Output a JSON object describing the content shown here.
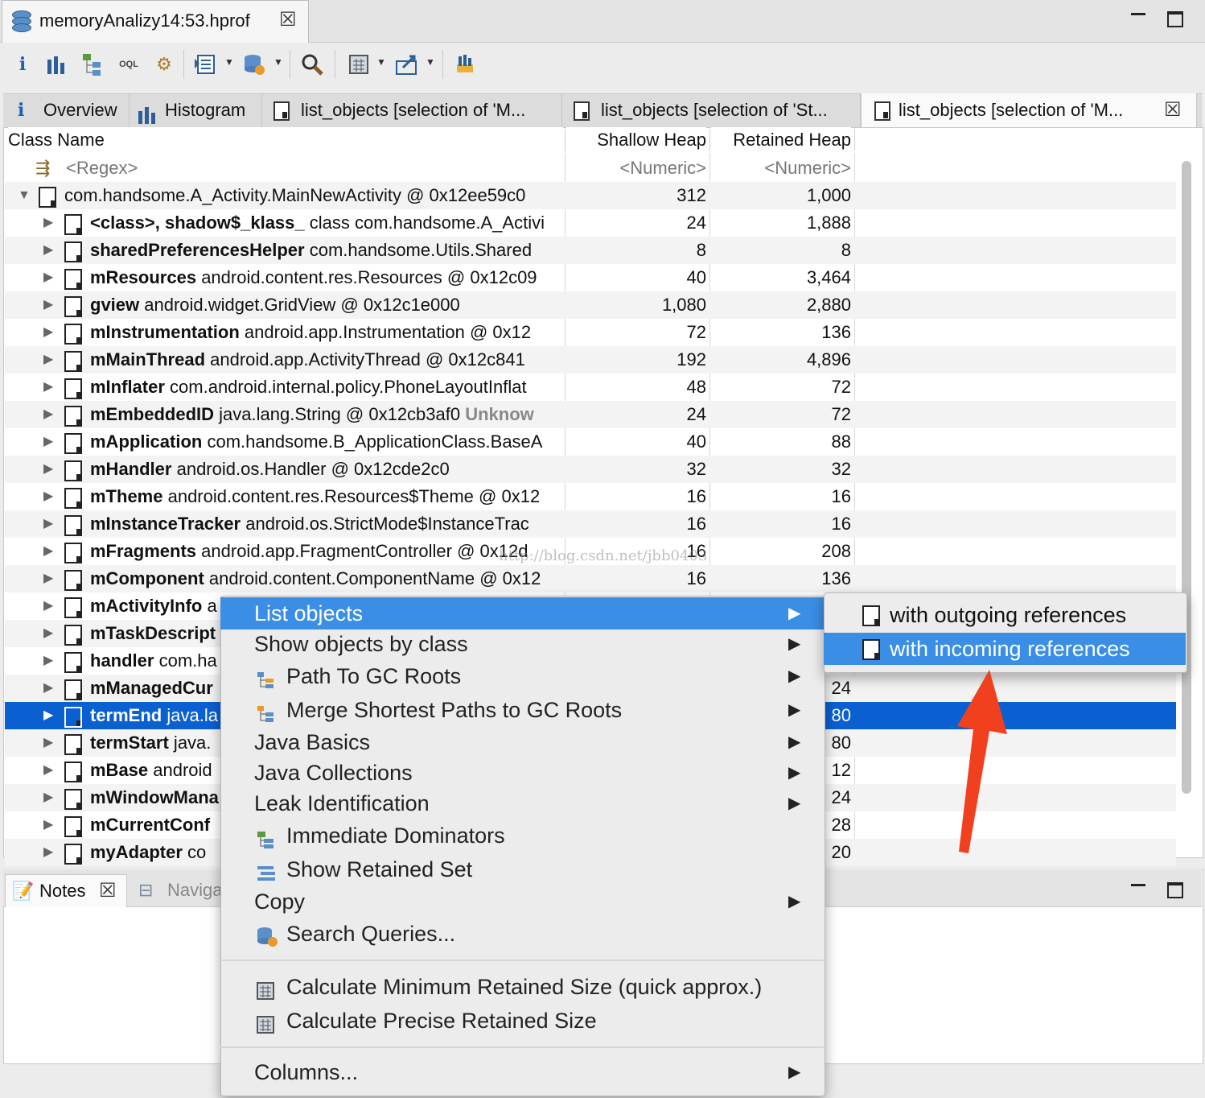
{
  "editor": {
    "tab_title": "memoryAnalizy14:53.hprof"
  },
  "toolbar": {
    "icons": [
      "info-icon",
      "histogram-icon",
      "dominator-tree-icon",
      "oql-icon",
      "thread-overview-icon",
      "query-browser-icon",
      "heap-dump-overview-icon",
      "search-icon",
      "calculator-icon",
      "export-icon",
      "group-icon"
    ]
  },
  "tabs": [
    {
      "label": "Overview",
      "icon": "info-icon"
    },
    {
      "label": "Histogram",
      "icon": "histogram-icon"
    },
    {
      "label": "list_objects [selection of 'M...",
      "icon": "file-icon"
    },
    {
      "label": "list_objects [selection of 'St...",
      "icon": "file-icon"
    },
    {
      "label": "list_objects [selection of 'M...",
      "icon": "file-icon",
      "active": true
    }
  ],
  "table": {
    "columns": [
      "Class Name",
      "Shallow Heap",
      "Retained Heap"
    ],
    "filter": {
      "name": "<Regex>",
      "shallow": "<Numeric>",
      "retained": "<Numeric>"
    },
    "root": {
      "name": "com.handsome.A_Activity.MainNewActivity @ 0x12ee59c0",
      "shallow": "312",
      "retained": "1,000"
    },
    "rows": [
      {
        "field": "<class>, shadow$_klass_",
        "rest": " class com.handsome.A_Activi",
        "shallow": "24",
        "retained": "1,888"
      },
      {
        "field": "sharedPreferencesHelper",
        "rest": " com.handsome.Utils.Shared",
        "shallow": "8",
        "retained": "8"
      },
      {
        "field": "mResources",
        "rest": " android.content.res.Resources @ 0x12c09",
        "shallow": "40",
        "retained": "3,464"
      },
      {
        "field": "gview",
        "rest": " android.widget.GridView @ 0x12c1e000",
        "shallow": "1,080",
        "retained": "2,880"
      },
      {
        "field": "mInstrumentation",
        "rest": " android.app.Instrumentation @ 0x12",
        "shallow": "72",
        "retained": "136"
      },
      {
        "field": "mMainThread",
        "rest": " android.app.ActivityThread @ 0x12c841",
        "shallow": "192",
        "retained": "4,896"
      },
      {
        "field": "mInflater",
        "rest": " com.android.internal.policy.PhoneLayoutInflat",
        "shallow": "48",
        "retained": "72"
      },
      {
        "field": "mEmbeddedID",
        "rest": " java.lang.String @ 0x12cb3af0 ",
        "extra": "Unknow",
        "shallow": "24",
        "retained": "72"
      },
      {
        "field": "mApplication",
        "rest": " com.handsome.B_ApplicationClass.BaseA",
        "shallow": "40",
        "retained": "88"
      },
      {
        "field": "mHandler",
        "rest": " android.os.Handler @ 0x12cde2c0",
        "shallow": "32",
        "retained": "32"
      },
      {
        "field": "mTheme",
        "rest": " android.content.res.Resources$Theme @ 0x12",
        "shallow": "16",
        "retained": "16"
      },
      {
        "field": "mInstanceTracker",
        "rest": " android.os.StrictMode$InstanceTrac",
        "shallow": "16",
        "retained": "16"
      },
      {
        "field": "mFragments",
        "rest": " android.app.FragmentController @ 0x12d",
        "shallow": "16",
        "retained": "208"
      },
      {
        "field": "mComponent",
        "rest": " android.content.ComponentName @ 0x12",
        "shallow": "16",
        "retained": "136"
      },
      {
        "field": "mActivityInfo",
        "rest": " a",
        "shallow": "",
        "retained": ""
      },
      {
        "field": "mTaskDescript",
        "rest": "",
        "shallow": "",
        "retained": ""
      },
      {
        "field": "handler",
        "rest": " com.ha",
        "shallow": "",
        "retained": ""
      },
      {
        "field": "mManagedCur",
        "rest": "",
        "shallow": "",
        "retained": "24"
      },
      {
        "field": "termEnd",
        "rest": " java.la",
        "shallow": "",
        "retained": "80",
        "selected": true
      },
      {
        "field": "termStart",
        "rest": " java.",
        "shallow": "",
        "retained": "80"
      },
      {
        "field": "mBase",
        "rest": " android",
        "shallow": "",
        "retained": "12"
      },
      {
        "field": "mWindowMana",
        "rest": "",
        "shallow": "",
        "retained": "24"
      },
      {
        "field": "mCurrentConf",
        "rest": "",
        "shallow": "",
        "retained": "28"
      },
      {
        "field": "myAdapter",
        "rest": " co",
        "shallow": "",
        "retained": "20"
      }
    ]
  },
  "bottom_tabs": [
    {
      "label": "Notes",
      "icon": "notes-icon"
    },
    {
      "label": "Naviga",
      "icon": "navigation-icon"
    }
  ],
  "context_menu": {
    "items": [
      {
        "label": "List objects",
        "submenu": true,
        "highlighted": true
      },
      {
        "label": "Show objects by class",
        "submenu": true
      },
      {
        "label": "Path To GC Roots",
        "submenu": true,
        "icon": "gc-roots-icon"
      },
      {
        "label": "Merge Shortest Paths to GC Roots",
        "submenu": true,
        "icon": "merge-paths-icon"
      },
      {
        "label": "Java Basics",
        "submenu": true
      },
      {
        "label": "Java Collections",
        "submenu": true
      },
      {
        "label": "Leak Identification",
        "submenu": true
      },
      {
        "label": "Immediate Dominators",
        "icon": "dominators-icon"
      },
      {
        "label": "Show Retained Set",
        "icon": "retained-set-icon"
      },
      {
        "label": "Copy",
        "submenu": true
      },
      {
        "label": "Search Queries...",
        "icon": "search-queries-icon"
      },
      {
        "label": "Calculate Minimum Retained Size (quick approx.)",
        "icon": "calculator-icon"
      },
      {
        "label": "Calculate Precise Retained Size",
        "icon": "calculator-icon"
      },
      {
        "label": "Columns...",
        "submenu": true
      }
    ]
  },
  "submenu": {
    "items": [
      {
        "label": "with outgoing references"
      },
      {
        "label": "with incoming references",
        "highlighted": true
      }
    ]
  },
  "watermark": "http://blog.csdn.net/jbb0403",
  "colors": {
    "selection": "#0a5fd1",
    "menu_highlight": "#3a8ee6",
    "annotation_arrow": "#f0401e"
  }
}
